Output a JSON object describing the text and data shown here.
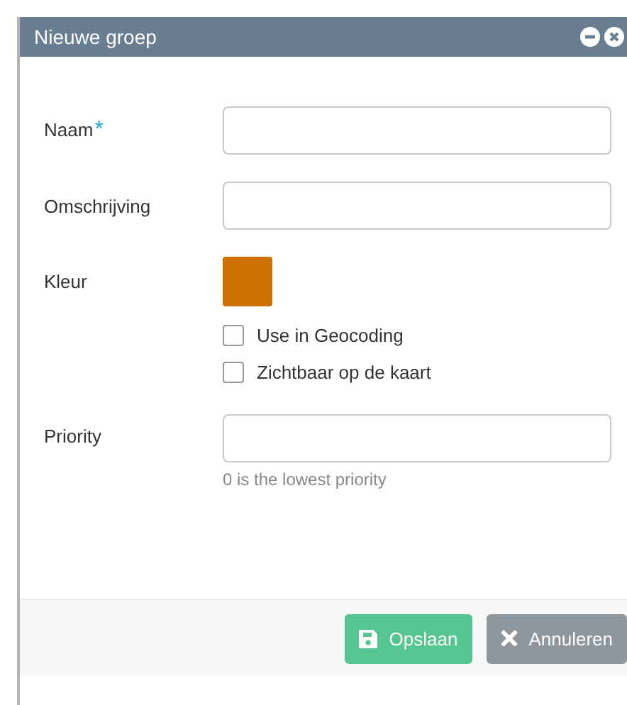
{
  "window": {
    "title": "Nieuwe groep"
  },
  "fields": [
    {
      "kind": "text",
      "label": "Naam",
      "required_mark": "*"
    },
    {
      "kind": "text",
      "label": "Omschrijving"
    },
    {
      "kind": "color",
      "label": "Kleur",
      "color": "#cc7000"
    },
    {
      "kind": "checkbox",
      "label": "Use in Geocoding",
      "checked": false
    },
    {
      "kind": "checkbox",
      "label": "Zichtbaar op de kaart",
      "checked": false
    },
    {
      "kind": "text",
      "label": "Priority",
      "hint": "0 is the lowest priority"
    }
  ],
  "buttons": [
    {
      "kind": "save",
      "label": "Opslaan"
    },
    {
      "kind": "cancel",
      "label": "Annuleren"
    }
  ]
}
